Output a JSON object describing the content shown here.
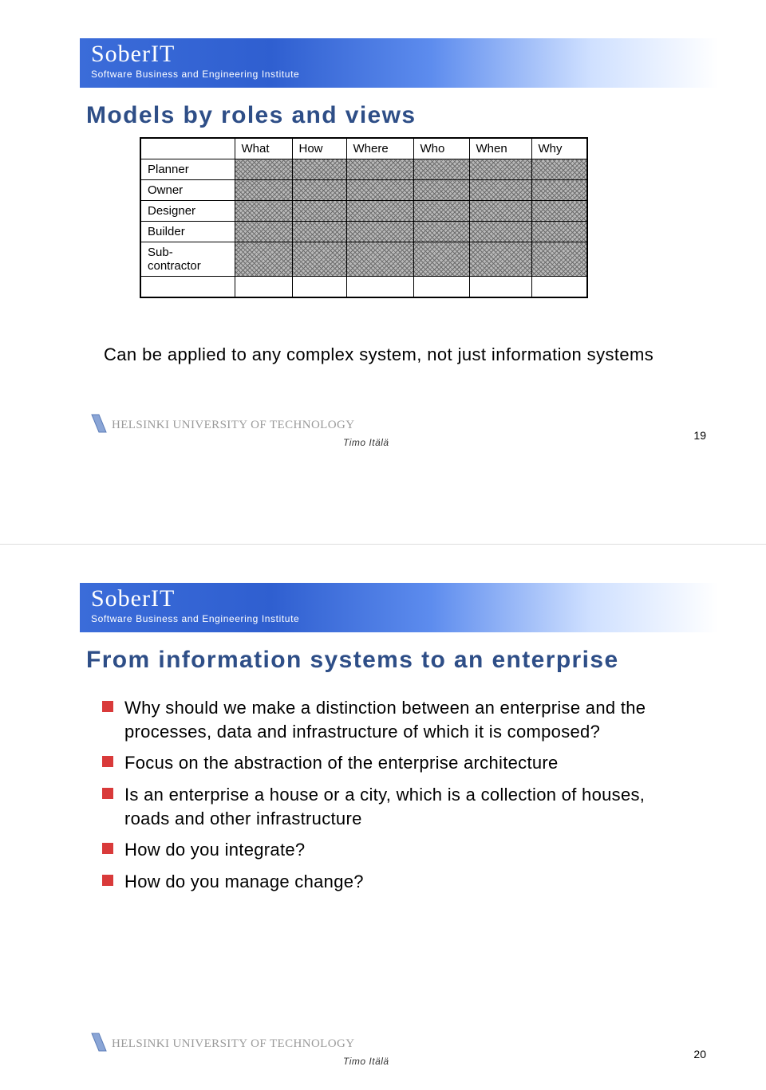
{
  "brand": {
    "title": "SoberIT",
    "subtitle": "Software Business and Engineering Institute"
  },
  "footer": {
    "university": "HELSINKI UNIVERSITY OF TECHNOLOGY",
    "author": "Timo Itälä"
  },
  "slide1": {
    "title": "Models by roles and views",
    "columns": [
      "What",
      "How",
      "Where",
      "Who",
      "When",
      "Why"
    ],
    "rows": [
      "Planner",
      "Owner",
      "Designer",
      "Builder",
      "Sub-\ncontractor"
    ],
    "caption": "Can be applied to any complex system, not just information systems",
    "page": "19"
  },
  "slide2": {
    "title": "From information systems to an enterprise",
    "bullets": [
      "Why should we make a distinction between an enterprise and the processes, data and infrastructure of which it is composed?",
      "Focus on the abstraction of the enterprise architecture",
      "Is an enterprise a house or a city, which is a collection of houses, roads and other infrastructure",
      "How do you integrate?",
      "How do you manage change?"
    ],
    "page": "20"
  }
}
